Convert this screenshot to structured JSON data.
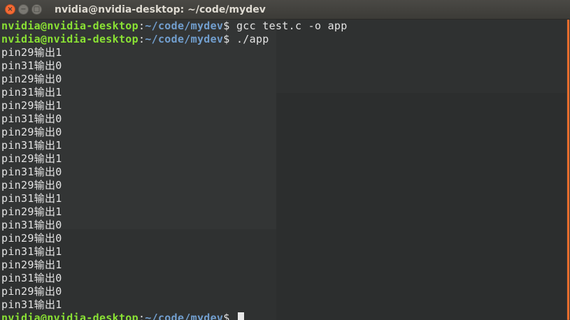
{
  "window": {
    "title": "nvidia@nvidia-desktop: ~/code/mydev",
    "buttons": {
      "close": "×",
      "minimize": "−",
      "maximize": "□"
    }
  },
  "terminal": {
    "prompts": [
      {
        "user": "nvidia@nvidia-desktop",
        "sep": ":",
        "path": "~/code/mydev",
        "symbol": "$",
        "command": "gcc test.c -o app"
      },
      {
        "user": "nvidia@nvidia-desktop",
        "sep": ":",
        "path": "~/code/mydev",
        "symbol": "$",
        "command": "./app"
      }
    ],
    "output": [
      "pin29输出1",
      "pin31输出0",
      "pin29输出0",
      "pin31输出1",
      "pin29输出1",
      "pin31输出0",
      "pin29输出0",
      "pin31输出1",
      "pin29输出1",
      "pin31输出0",
      "pin29输出0",
      "pin31输出1",
      "pin29输出1",
      "pin31输出0",
      "pin29输出0",
      "pin31输出1",
      "pin29输出1",
      "pin31输出0",
      "pin29输出0",
      "pin31输出1"
    ],
    "final_prompt": {
      "user": "nvidia@nvidia-desktop",
      "sep": ":",
      "path": "~/code/mydev",
      "symbol": "$"
    }
  },
  "colors": {
    "prompt_user": "#8ae234",
    "prompt_path": "#729fcf",
    "text": "#e4e4e4",
    "background": "#2f3131",
    "close_button": "#f46a34",
    "scrollbar": "#e96d2c"
  },
  "icons": {
    "close": "close-icon",
    "minimize": "minimize-icon",
    "maximize": "maximize-icon"
  }
}
